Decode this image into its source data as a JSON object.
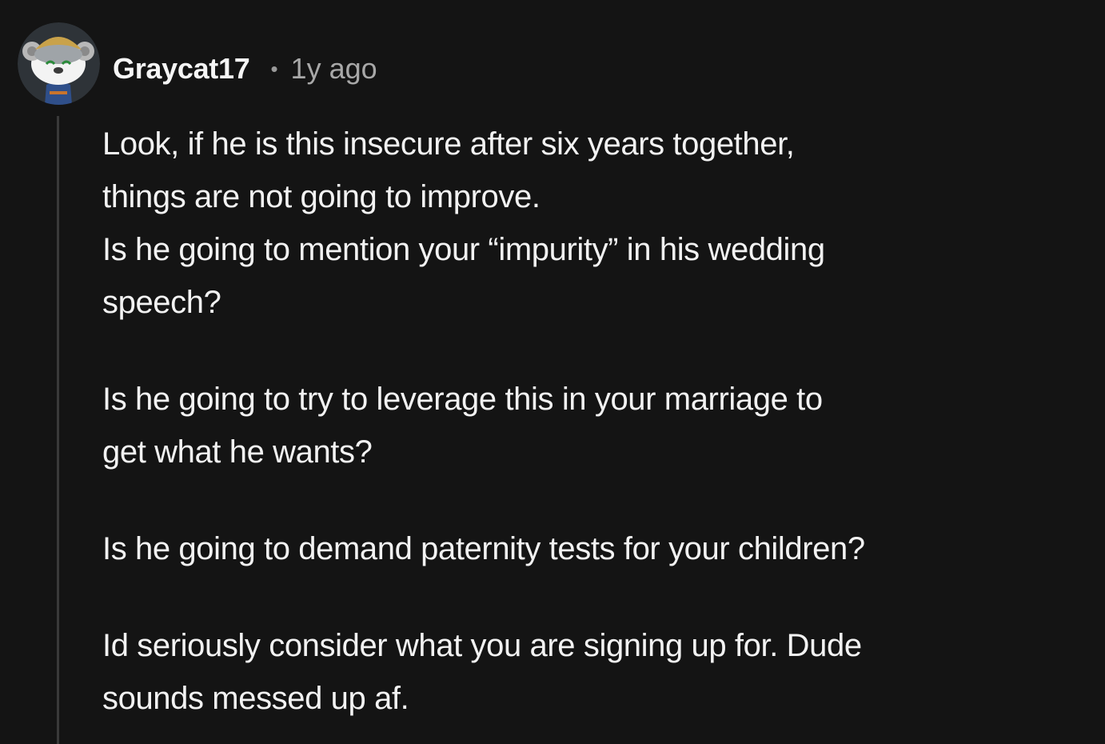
{
  "comment": {
    "username": "Graycat17",
    "separator": "•",
    "timestamp": "1y ago",
    "avatar_icon": "snoo-avatar-icon",
    "paragraphs": [
      "Look, if he is this insecure after six years together,\nthings are not going to improve.\nIs he going to mention your “impurity” in his wedding\nspeech?",
      "Is he going to try to leverage this in your marriage to\nget what he wants?",
      "Is he going to demand paternity tests for your children?",
      "Id seriously consider what you are signing up for. Dude\nsounds messed up af."
    ]
  },
  "colors": {
    "background": "#141414",
    "text": "#f2f2f2",
    "muted": "#a8a8a8",
    "thread_line": "#3a3a3a"
  }
}
